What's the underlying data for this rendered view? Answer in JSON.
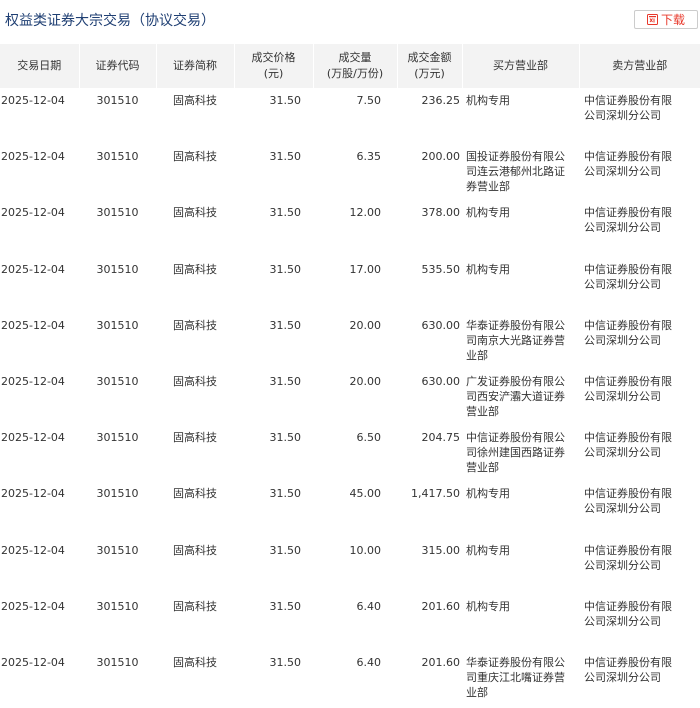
{
  "header": {
    "title": "权益类证券大宗交易（协议交易）",
    "download_label": "下载",
    "download_icon": "excel-download-icon",
    "accent_color": "#e8382b",
    "title_color": "#1f3f73"
  },
  "table": {
    "columns": [
      {
        "line1": "交易日期",
        "line2": ""
      },
      {
        "line1": "证券代码",
        "line2": ""
      },
      {
        "line1": "证券简称",
        "line2": ""
      },
      {
        "line1": "成交价格",
        "line2": "(元)"
      },
      {
        "line1": "成交量",
        "line2": "(万股/万份)"
      },
      {
        "line1": "成交金额",
        "line2": "(万元)"
      },
      {
        "line1": "买方营业部",
        "line2": ""
      },
      {
        "line1": "卖方营业部",
        "line2": ""
      }
    ],
    "rows": [
      {
        "date": "2025-12-04",
        "code": "301510",
        "name": "固高科技",
        "price": "31.50",
        "volume": "7.50",
        "amount": "236.25",
        "buyer": "机构专用",
        "seller": "中信证券股份有限公司深圳分公司"
      },
      {
        "date": "2025-12-04",
        "code": "301510",
        "name": "固高科技",
        "price": "31.50",
        "volume": "6.35",
        "amount": "200.00",
        "buyer": "国投证券股份有限公司连云港郁州北路证券营业部",
        "seller": "中信证券股份有限公司深圳分公司"
      },
      {
        "date": "2025-12-04",
        "code": "301510",
        "name": "固高科技",
        "price": "31.50",
        "volume": "12.00",
        "amount": "378.00",
        "buyer": "机构专用",
        "seller": "中信证券股份有限公司深圳分公司"
      },
      {
        "date": "2025-12-04",
        "code": "301510",
        "name": "固高科技",
        "price": "31.50",
        "volume": "17.00",
        "amount": "535.50",
        "buyer": "机构专用",
        "seller": "中信证券股份有限公司深圳分公司"
      },
      {
        "date": "2025-12-04",
        "code": "301510",
        "name": "固高科技",
        "price": "31.50",
        "volume": "20.00",
        "amount": "630.00",
        "buyer": "华泰证券股份有限公司南京大光路证券营业部",
        "seller": "中信证券股份有限公司深圳分公司"
      },
      {
        "date": "2025-12-04",
        "code": "301510",
        "name": "固高科技",
        "price": "31.50",
        "volume": "20.00",
        "amount": "630.00",
        "buyer": "广发证券股份有限公司西安浐灞大道证券营业部",
        "seller": "中信证券股份有限公司深圳分公司"
      },
      {
        "date": "2025-12-04",
        "code": "301510",
        "name": "固高科技",
        "price": "31.50",
        "volume": "6.50",
        "amount": "204.75",
        "buyer": "中信证券股份有限公司徐州建国西路证券营业部",
        "seller": "中信证券股份有限公司深圳分公司"
      },
      {
        "date": "2025-12-04",
        "code": "301510",
        "name": "固高科技",
        "price": "31.50",
        "volume": "45.00",
        "amount": "1,417.50",
        "buyer": "机构专用",
        "seller": "中信证券股份有限公司深圳分公司"
      },
      {
        "date": "2025-12-04",
        "code": "301510",
        "name": "固高科技",
        "price": "31.50",
        "volume": "10.00",
        "amount": "315.00",
        "buyer": "机构专用",
        "seller": "中信证券股份有限公司深圳分公司"
      },
      {
        "date": "2025-12-04",
        "code": "301510",
        "name": "固高科技",
        "price": "31.50",
        "volume": "6.40",
        "amount": "201.60",
        "buyer": "机构专用",
        "seller": "中信证券股份有限公司深圳分公司"
      },
      {
        "date": "2025-12-04",
        "code": "301510",
        "name": "固高科技",
        "price": "31.50",
        "volume": "6.40",
        "amount": "201.60",
        "buyer": "华泰证券股份有限公司重庆江北嘴证券营业部",
        "seller": "中信证券股份有限公司深圳分公司"
      }
    ]
  }
}
